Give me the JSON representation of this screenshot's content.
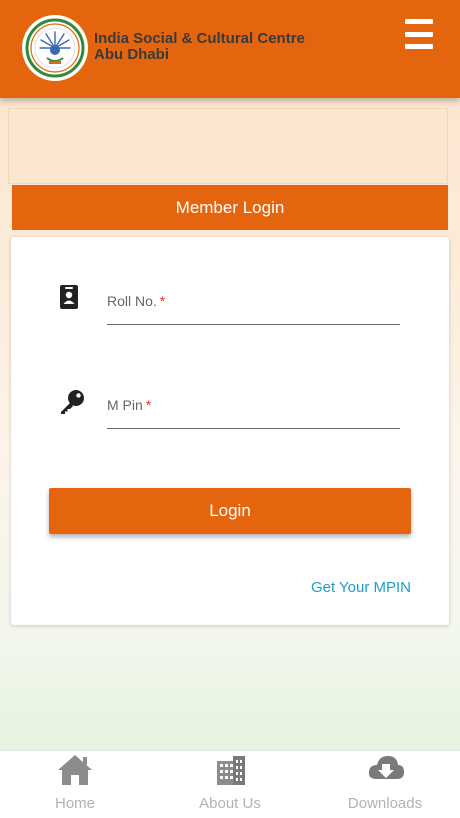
{
  "header": {
    "title_line1": "India Social & Cultural Centre",
    "title_line2": "Abu Dhabi",
    "menu_icon": "hamburger-menu-icon",
    "background_color": "#e5650e"
  },
  "login": {
    "heading": "Member Login",
    "roll_no": {
      "label": "Roll No.",
      "required_mark": "*",
      "icon": "id-badge-icon",
      "value": ""
    },
    "mpin": {
      "label": "M Pin",
      "required_mark": "*",
      "icon": "key-icon",
      "value": ""
    },
    "submit_label": "Login",
    "get_mpin_link": "Get Your MPIN",
    "accent_color": "#e5650e",
    "link_color": "#1f9dc9"
  },
  "bottom_nav": {
    "items": [
      {
        "label": "Home",
        "icon": "home-icon"
      },
      {
        "label": "About Us",
        "icon": "building-icon"
      },
      {
        "label": "Downloads",
        "icon": "cloud-download-icon"
      }
    ]
  }
}
